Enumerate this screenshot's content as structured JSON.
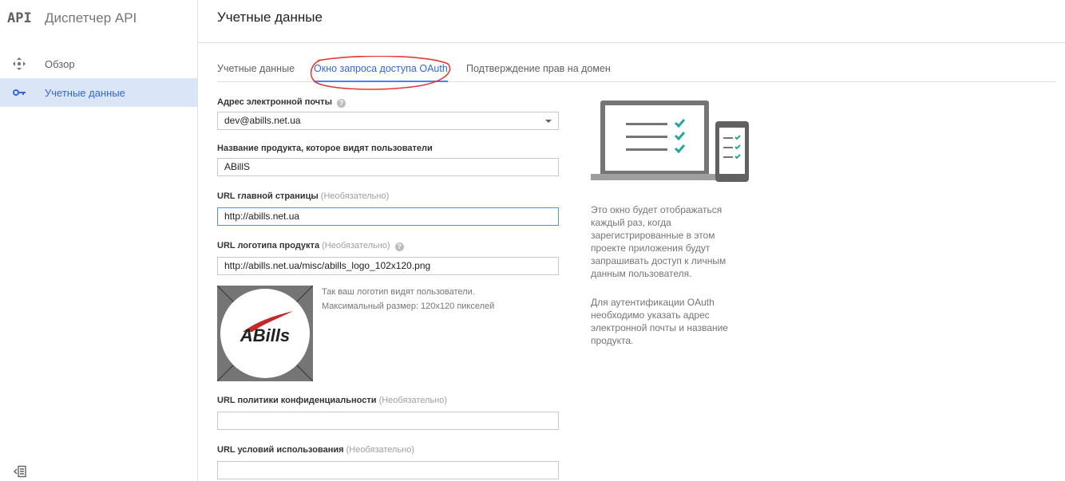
{
  "sidebar": {
    "logo": "API",
    "title": "Диспетчер API",
    "items": [
      {
        "label": "Обзор",
        "icon": "overview-icon"
      },
      {
        "label": "Учетные данные",
        "icon": "key-icon"
      }
    ],
    "active_index": 1
  },
  "header": {
    "title": "Учетные данные"
  },
  "tabs": [
    {
      "label": "Учетные данные"
    },
    {
      "label": "Окно запроса доступа OAuth"
    },
    {
      "label": "Подтверждение прав на домен"
    }
  ],
  "active_tab": 1,
  "form": {
    "email": {
      "label": "Адрес электронной почты",
      "value": "dev@abills.net.ua"
    },
    "product_name": {
      "label": "Название продукта, которое видят пользователи",
      "value": "ABillS"
    },
    "homepage": {
      "label": "URL главной страницы",
      "optional": "(Необязательно)",
      "value": "http://abills.net.ua"
    },
    "logo_url": {
      "label": "URL логотипа продукта",
      "optional": "(Необязательно)",
      "value": "http://abills.net.ua/misc/abills_logo_102x120.png"
    },
    "logo_hint_1": "Так ваш логотип видят пользователи.",
    "logo_hint_2": "Максимальный размер: 120x120 пикселей",
    "logo_text": "ABills",
    "privacy": {
      "label": "URL политики конфиденциальности",
      "optional": "(Необязательно)",
      "value": ""
    },
    "terms": {
      "label": "URL условий использования",
      "optional": "(Необязательно)",
      "value": ""
    }
  },
  "info": {
    "p1": "Это окно будет отображаться каждый раз, когда зарегистрированные в этом проекте приложения будут запрашивать доступ к личным данным пользователя.",
    "p2": "Для аутентификации OAuth необходимо указать адрес электронной почты и название продукта."
  },
  "colors": {
    "accent": "#4285f4",
    "active_text": "#3367d6",
    "active_bg": "#dbe5f8",
    "annotation": "#e53935",
    "check": "#26a69a",
    "logo_red": "#d32f2f"
  }
}
